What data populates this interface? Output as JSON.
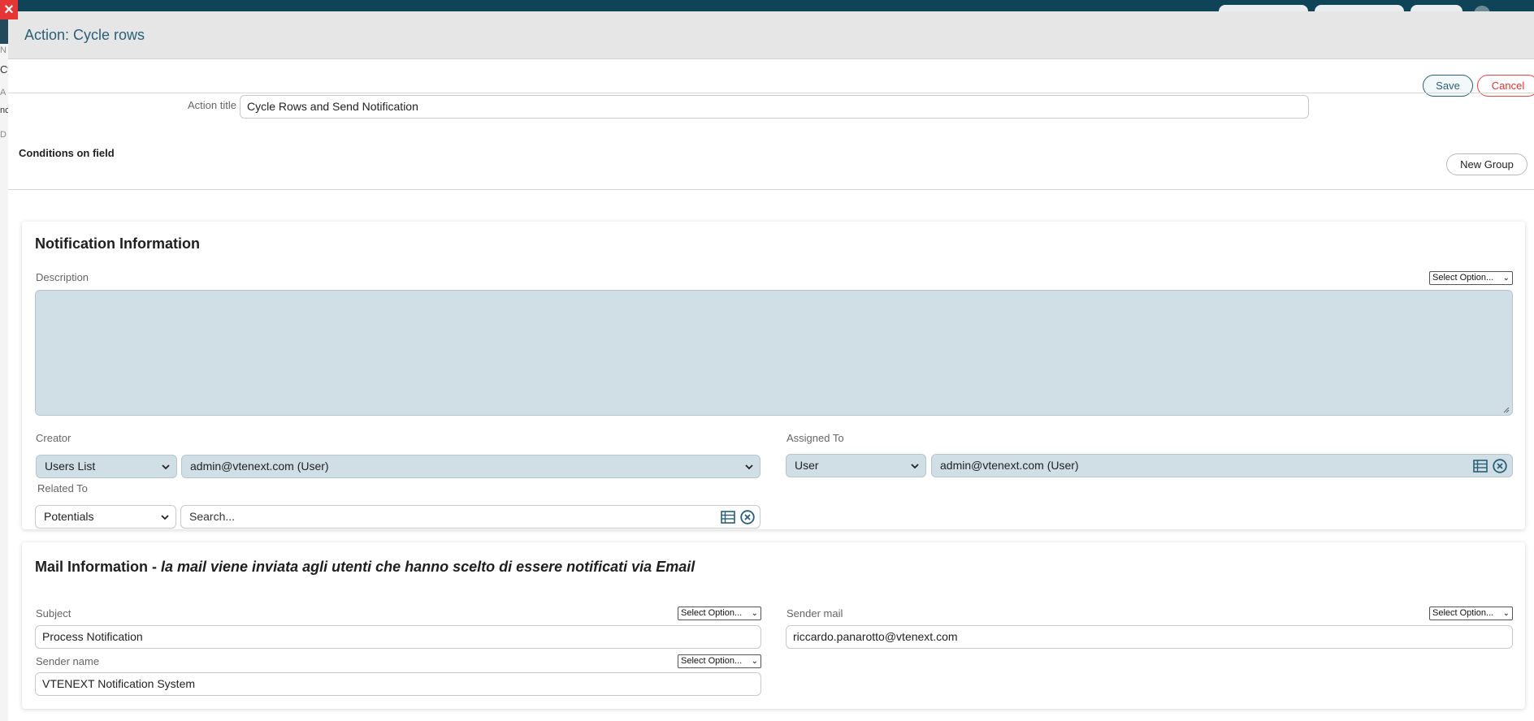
{
  "background": {
    "close_glyph": "×",
    "left_fragments": [
      "N",
      "Cy",
      "A",
      "nc",
      "D"
    ]
  },
  "dialog": {
    "title": "Action: Cycle rows",
    "save_label": "Save",
    "cancel_label": "Cancel",
    "action_title_label": "Action title",
    "action_title_value": "Cycle Rows and Send Notification",
    "conditions_label": "Conditions on field",
    "new_group_label": "New Group"
  },
  "notification": {
    "title": "Notification Information",
    "description_label": "Description",
    "description_select": "Select Option...",
    "creator_label": "Creator",
    "creator_type": "Users List",
    "creator_value": "admin@vtenext.com (User)",
    "assigned_label": "Assigned To",
    "assigned_type": "User",
    "assigned_value": "admin@vtenext.com (User)",
    "related_label": "Related To",
    "related_type": "Potentials",
    "related_placeholder": "Search..."
  },
  "mail": {
    "title": "Mail Information",
    "title_separator": " - ",
    "title_note": "la mail viene inviata agli utenti che hanno scelto di essere notificati via Email",
    "subject_label": "Subject",
    "subject_select": "Select Option...",
    "subject_value": "Process Notification",
    "sender_mail_label": "Sender mail",
    "sender_mail_select": "Select Option...",
    "sender_mail_value": "riccardo.panarotto@vtenext.com",
    "sender_name_label": "Sender name",
    "sender_name_select": "Select Option...",
    "sender_name_value": "VTENEXT Notification System"
  },
  "colors": {
    "accent": "#2a5f77",
    "cancel": "#e04848",
    "topbar": "#0f4358",
    "field_fill": "#cfdfe5"
  },
  "icons": {
    "list": "list-icon",
    "clear": "clear-circle-icon",
    "dropdown": "chevron-down-icon"
  }
}
